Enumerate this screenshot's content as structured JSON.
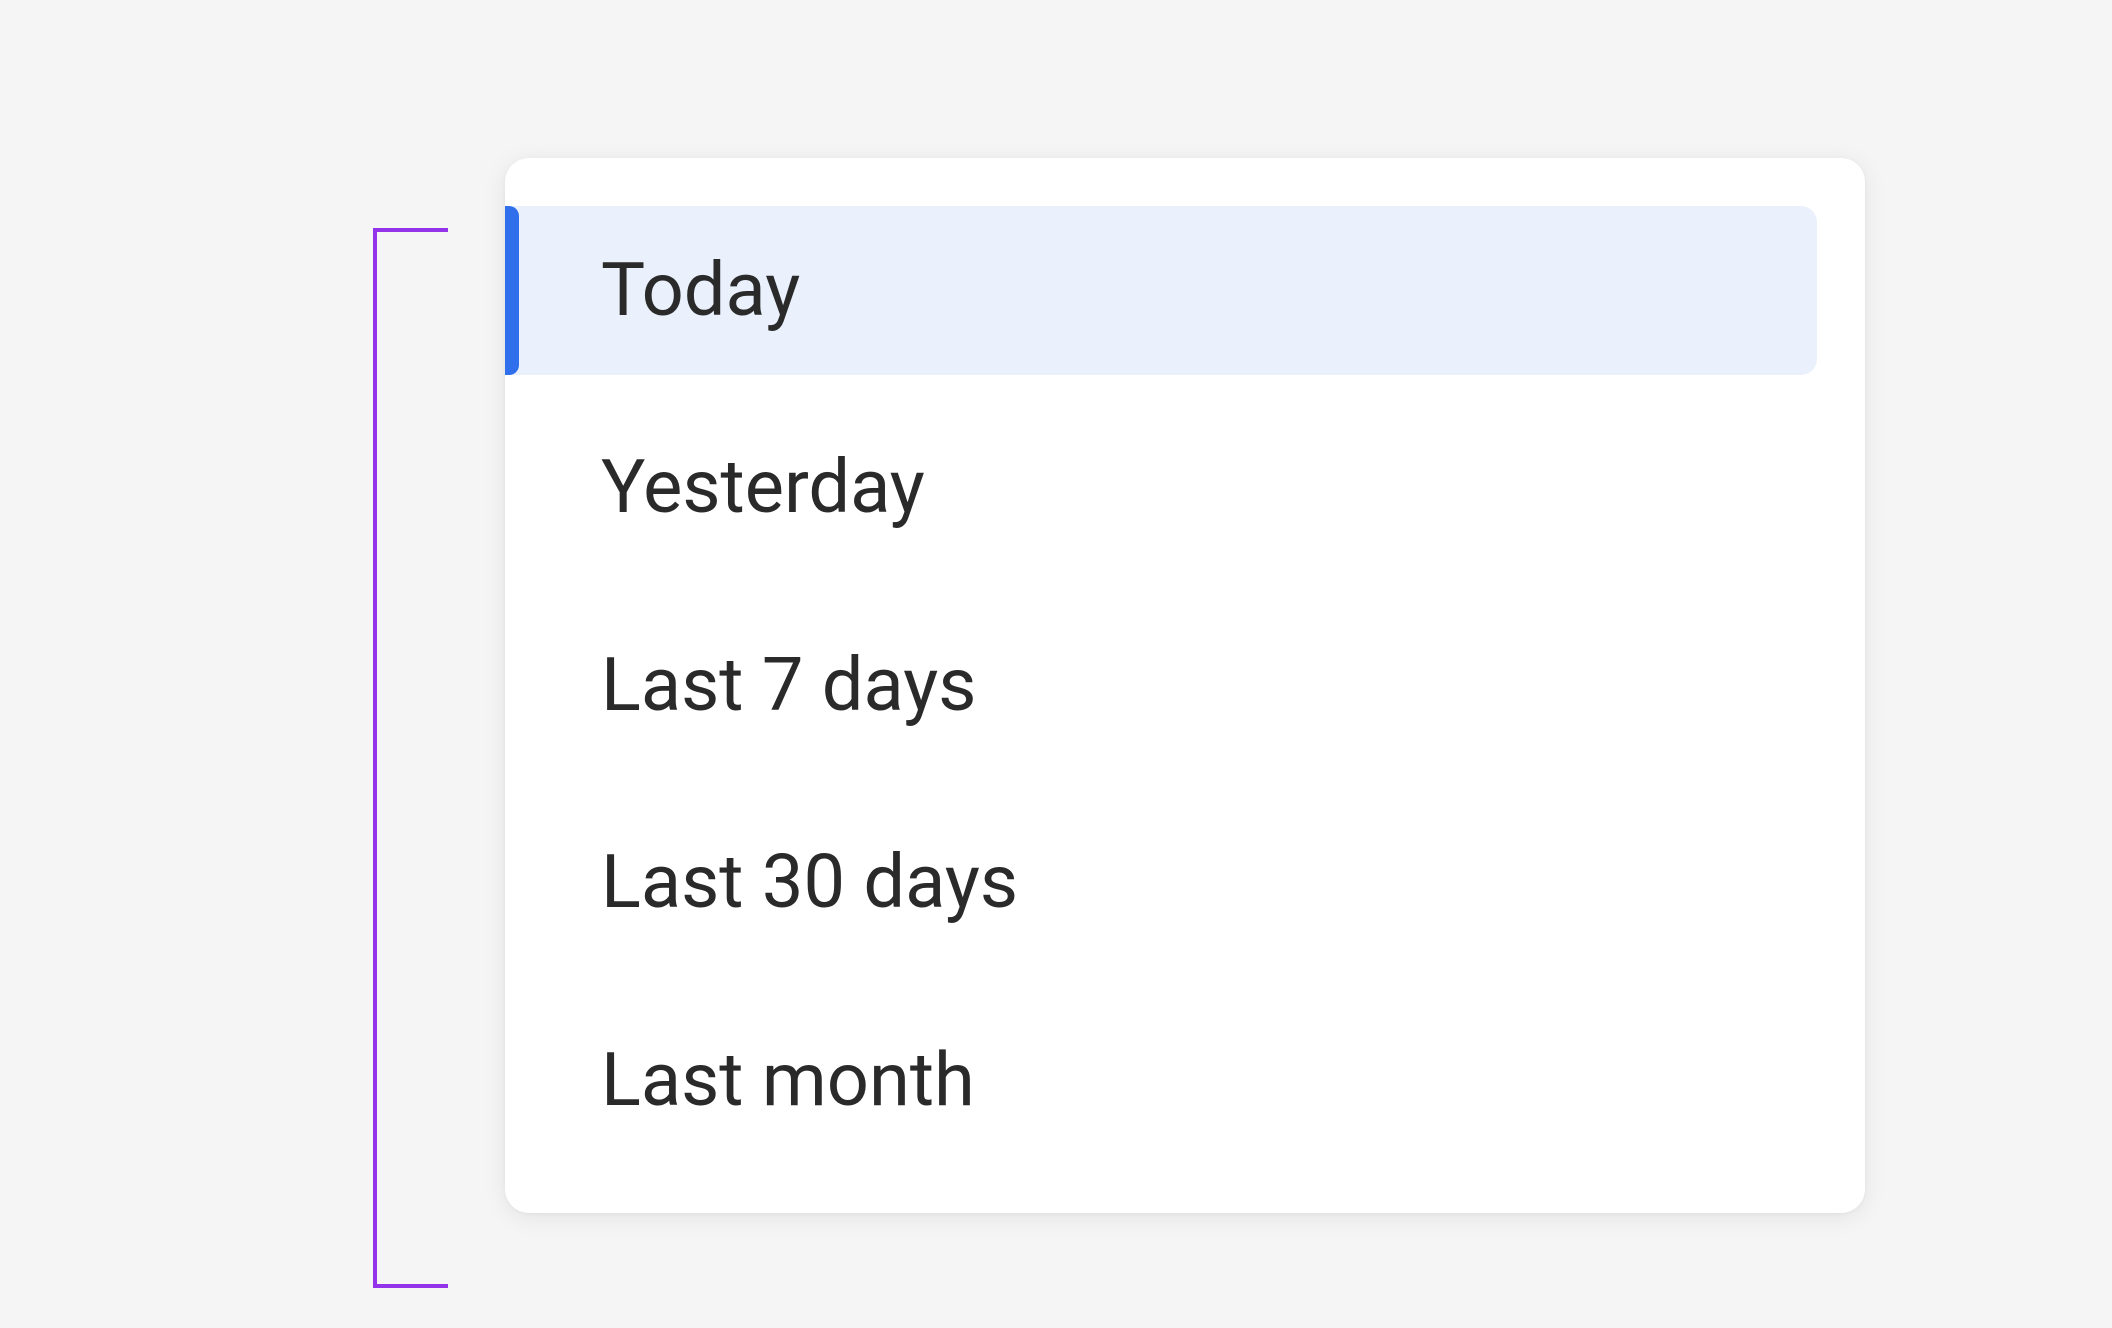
{
  "dateRangeMenu": {
    "items": [
      {
        "label": "Today",
        "selected": true
      },
      {
        "label": "Yesterday",
        "selected": false
      },
      {
        "label": "Last 7 days",
        "selected": false
      },
      {
        "label": "Last 30 days",
        "selected": false
      },
      {
        "label": "Last month",
        "selected": false
      }
    ]
  },
  "colors": {
    "accent": "#2f6feb",
    "selectedBg": "#eaf1fc",
    "annotation": "#9333ea"
  }
}
